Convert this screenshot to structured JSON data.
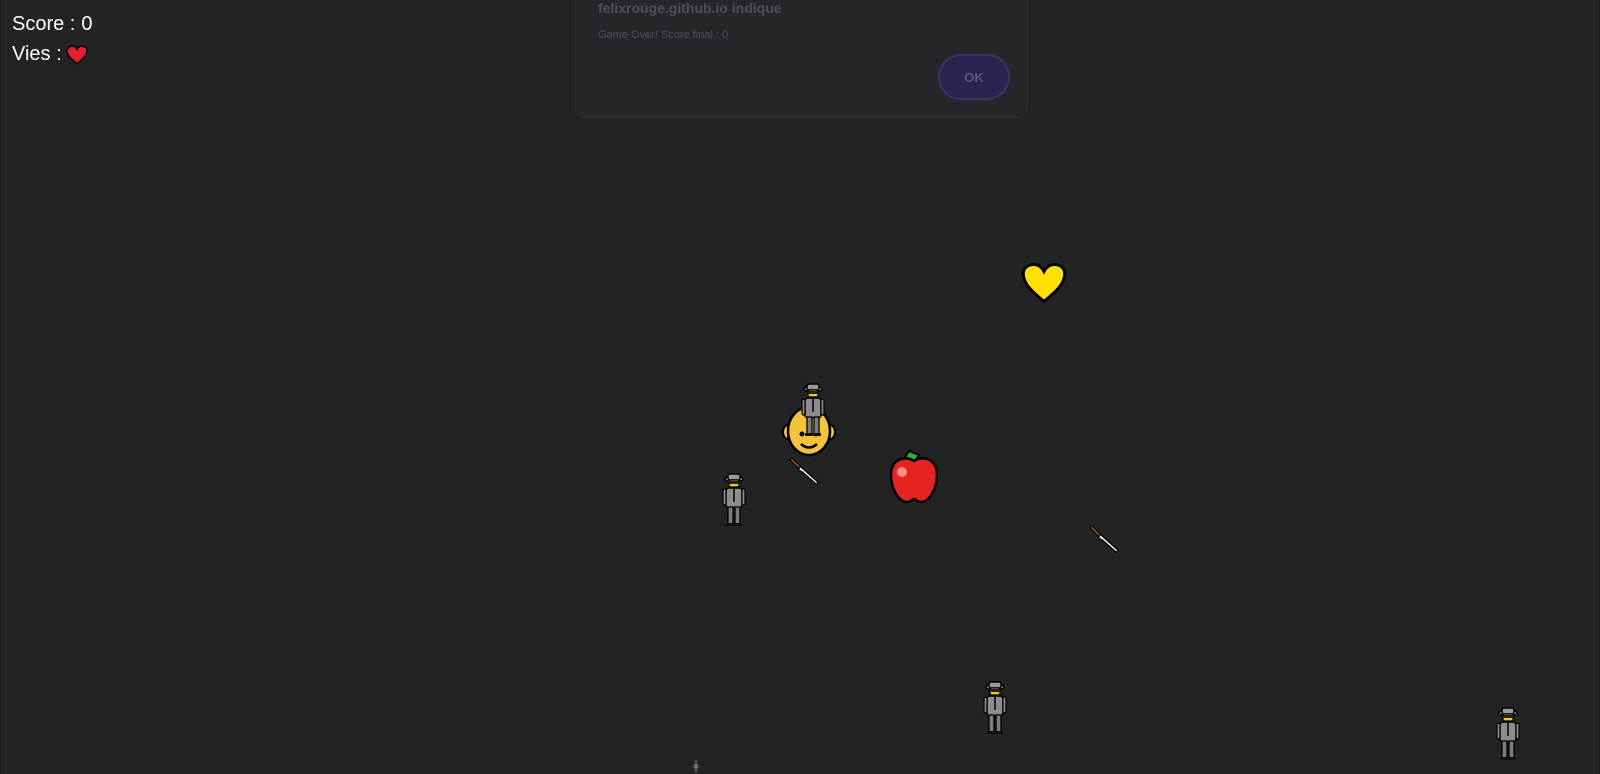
{
  "hud": {
    "score_label": "Score :",
    "score_value": "0",
    "lives_label": "Vies :",
    "lives_count": 1,
    "life_icon": "red-heart-icon"
  },
  "dialog": {
    "title": "felixrouge.github.io indique",
    "message": "Game Over! Score final : 0",
    "ok_label": "OK"
  },
  "entities": [
    {
      "type": "player",
      "icon": "bald-man-face-icon"
    },
    {
      "type": "enemy",
      "icon": "spy-detective-icon"
    },
    {
      "type": "enemy",
      "icon": "spy-detective-icon"
    },
    {
      "type": "enemy",
      "icon": "spy-detective-icon"
    },
    {
      "type": "enemy",
      "icon": "spy-detective-icon"
    },
    {
      "type": "enemy",
      "icon": "spy-detective-icon"
    },
    {
      "type": "projectile",
      "icon": "knife-icon"
    },
    {
      "type": "projectile",
      "icon": "knife-icon"
    },
    {
      "type": "pickup",
      "icon": "red-apple-icon"
    },
    {
      "type": "pickup",
      "icon": "yellow-heart-icon"
    }
  ],
  "colors": {
    "background": "#232323",
    "hud_text": "#ffffff",
    "life_heart": "#e0202a",
    "yellow_heart": "#ffe000",
    "apple": "#e52421"
  }
}
